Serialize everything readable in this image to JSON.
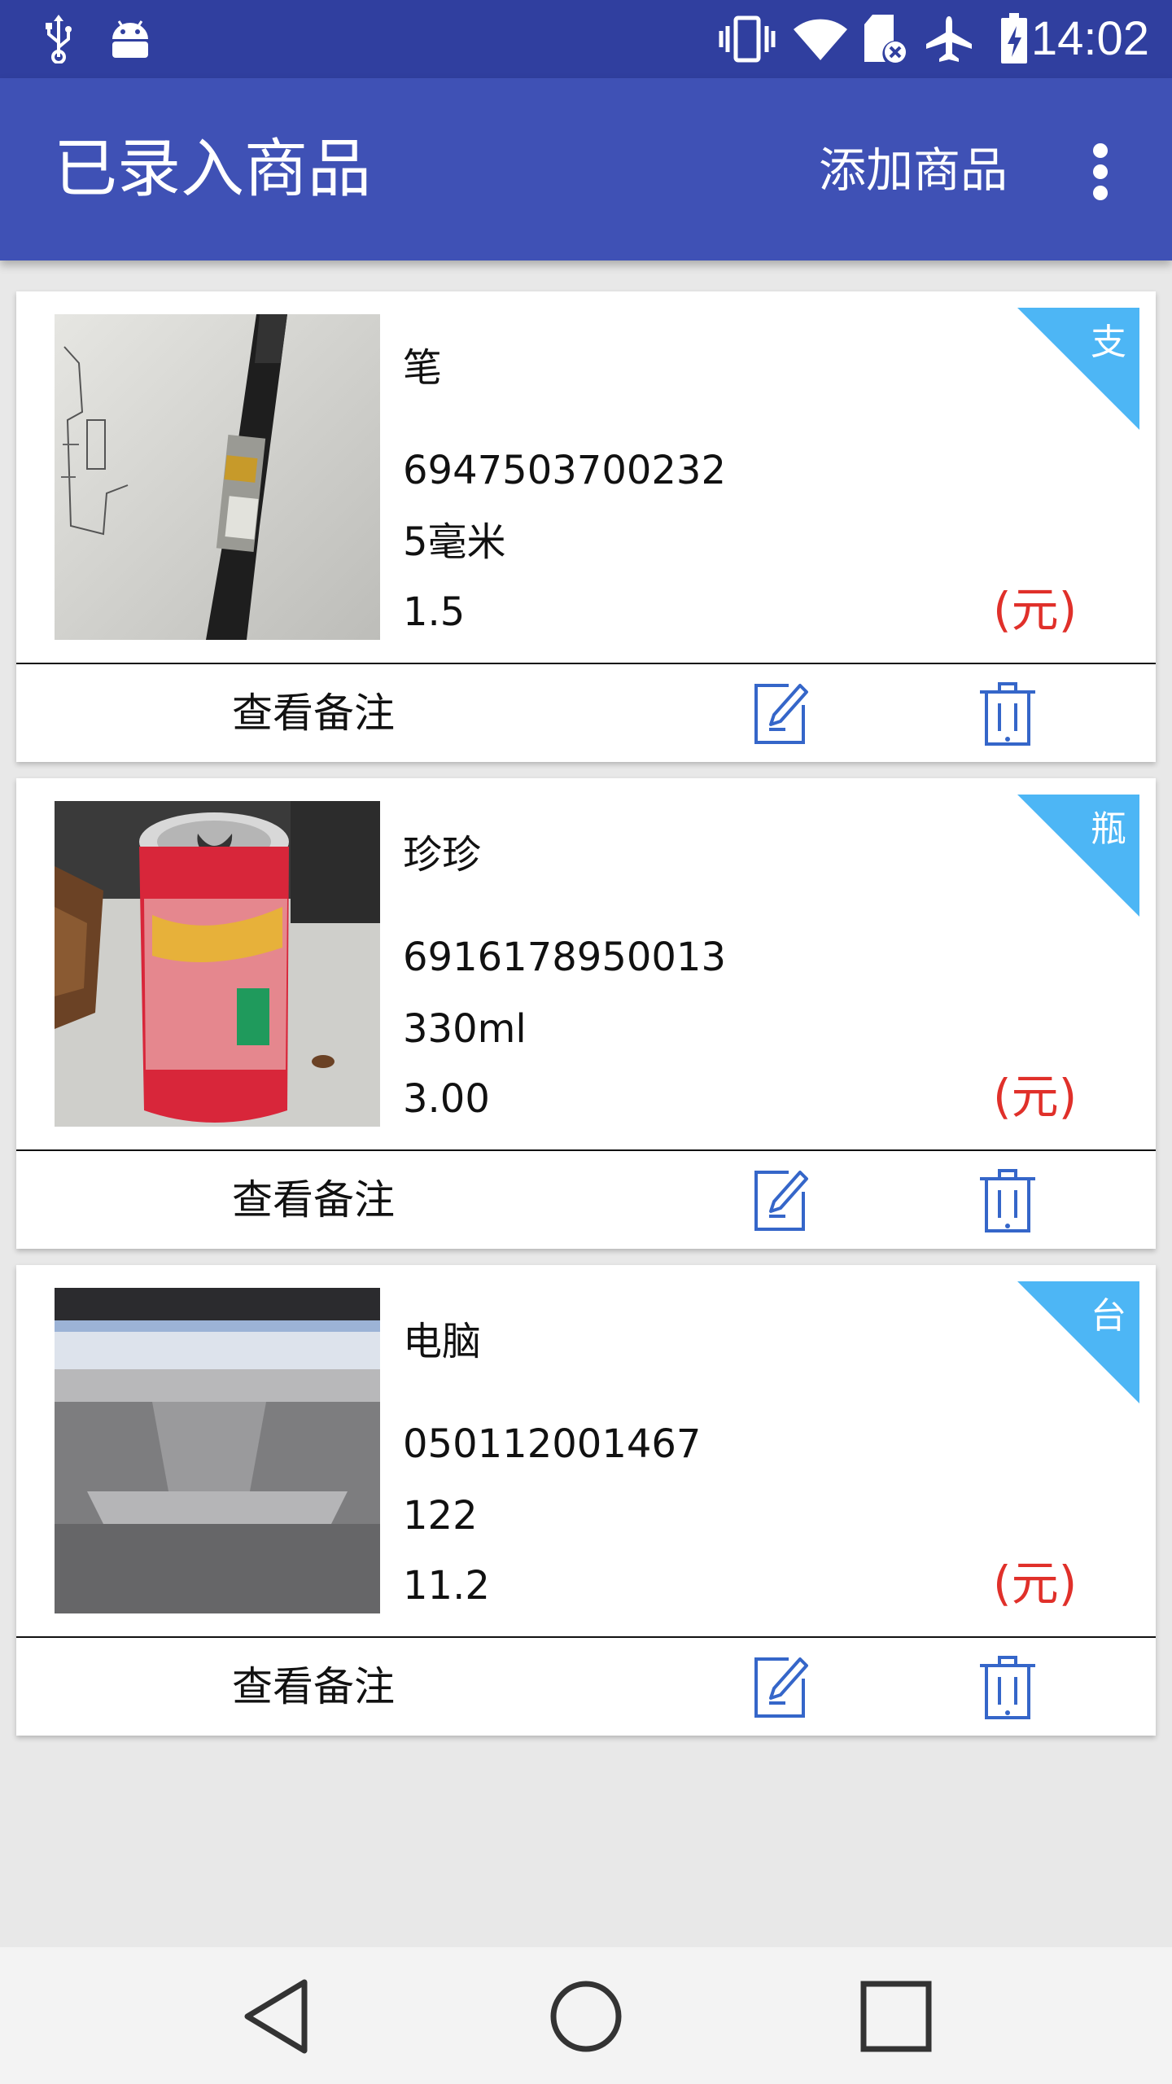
{
  "status_bar": {
    "time": "14:02",
    "left_icons": [
      "usb-icon",
      "android-icon"
    ],
    "right_icons": [
      "vibrate-icon",
      "wifi-icon",
      "sd-card-off-icon",
      "airplane-icon",
      "battery-charging-icon"
    ]
  },
  "app_bar": {
    "title": "已录入商品",
    "add_label": "添加商品",
    "overflow_icon": "more-vert-icon"
  },
  "colors": {
    "status_bar": "#303f9f",
    "app_bar": "#3f51b5",
    "corner_badge": "#4db6f5",
    "currency_text": "#e0302a",
    "icon_blue": "#3566c9"
  },
  "products": [
    {
      "name": "笔",
      "barcode": "6947503700232",
      "spec": "5毫米",
      "price": "1.5",
      "currency": "(元)",
      "unit": "支",
      "note_label": "查看备注",
      "image": "pen-photo"
    },
    {
      "name": "珍珍",
      "barcode": "6916178950013",
      "spec": "330ml",
      "price": "3.00",
      "currency": "(元)",
      "unit": "瓶",
      "note_label": "查看备注",
      "image": "can-photo"
    },
    {
      "name": "电脑",
      "barcode": "050112001467",
      "spec": "122",
      "price": "11.2",
      "currency": "(元)",
      "unit": "台",
      "note_label": "查看备注",
      "image": "monitor-photo"
    }
  ],
  "nav_bar": {
    "buttons": [
      "back-icon",
      "home-icon",
      "recents-icon"
    ]
  }
}
